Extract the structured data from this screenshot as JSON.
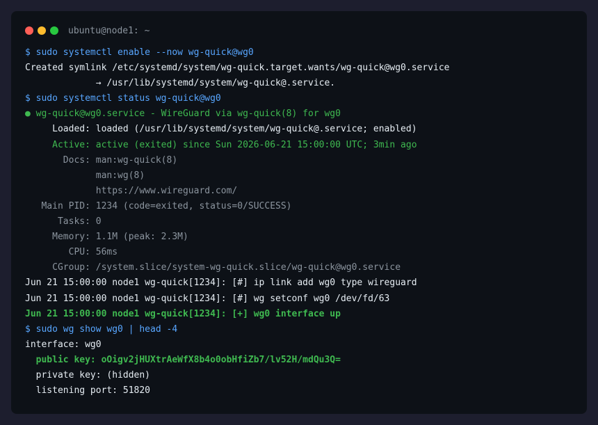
{
  "window": {
    "title": "ubuntu@node1: ~"
  },
  "lines": [
    {
      "text": "$ sudo systemctl enable --now wg-quick@wg0",
      "style": "cmd"
    },
    {
      "text": "Created symlink /etc/systemd/system/wg-quick.target.wants/wg-quick@wg0.service",
      "style": "out"
    },
    {
      "text": "             → /usr/lib/systemd/system/wg-quick@.service.",
      "style": "out"
    },
    {
      "text": "$ sudo systemctl status wg-quick@wg0",
      "style": "cmd"
    },
    {
      "text": "● wg-quick@wg0.service - WireGuard via wg-quick(8) for wg0",
      "style": "green"
    },
    {
      "text": "     Loaded: loaded (/usr/lib/systemd/system/wg-quick@.service; enabled)",
      "style": "out"
    },
    {
      "text": "     Active: active (exited) since Sun 2026-06-21 15:00:00 UTC; 3min ago",
      "style": "green"
    },
    {
      "text": "       Docs: man:wg-quick(8)",
      "style": "dim"
    },
    {
      "text": "             man:wg(8)",
      "style": "dim"
    },
    {
      "text": "             https://www.wireguard.com/",
      "style": "dim"
    },
    {
      "text": "   Main PID: 1234 (code=exited, status=0/SUCCESS)",
      "style": "dim"
    },
    {
      "text": "      Tasks: 0",
      "style": "dim"
    },
    {
      "text": "     Memory: 1.1M (peak: 2.3M)",
      "style": "dim"
    },
    {
      "text": "        CPU: 56ms",
      "style": "dim"
    },
    {
      "text": "     CGroup: /system.slice/system-wg-quick.slice/wg-quick@wg0.service",
      "style": "dim"
    },
    {
      "text": "Jun 21 15:00:00 node1 wg-quick[1234]: [#] ip link add wg0 type wireguard",
      "style": "out"
    },
    {
      "text": "Jun 21 15:00:00 node1 wg-quick[1234]: [#] wg setconf wg0 /dev/fd/63",
      "style": "out"
    },
    {
      "text": "Jun 21 15:00:00 node1 wg-quick[1234]: [+] wg0 interface up",
      "style": "bold-green"
    },
    {
      "text": "$ sudo wg show wg0 | head -4",
      "style": "cmd"
    },
    {
      "text": "interface: wg0",
      "style": "out"
    },
    {
      "text": "  public key: oOigv2jHUXtrAeWfX8b4o0obHfiZb7/lv52H/mdQu3Q=",
      "style": "bold-green"
    },
    {
      "text": "  private key: (hidden)",
      "style": "out"
    },
    {
      "text": "  listening port: 51820",
      "style": "out"
    }
  ],
  "colors": {
    "command": "#58a6ff",
    "output": "#e6edf3",
    "success": "#3fb950",
    "muted": "#8b949e",
    "background": "#0d1117"
  }
}
